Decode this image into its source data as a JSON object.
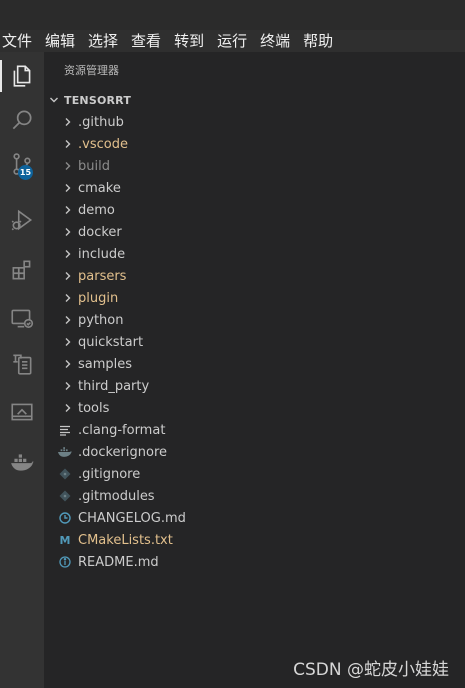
{
  "menubar": {
    "items": [
      "文件",
      "编辑",
      "选择",
      "查看",
      "转到",
      "运行",
      "终端",
      "帮助"
    ]
  },
  "activity_bar": {
    "items": [
      {
        "icon": "explorer-icon",
        "active": true
      },
      {
        "icon": "search-icon"
      },
      {
        "icon": "source-control-icon",
        "badge": "15"
      },
      {
        "icon": "run-debug-icon"
      },
      {
        "icon": "extensions-icon"
      },
      {
        "icon": "remote-explorer-icon"
      },
      {
        "icon": "testing-icon"
      },
      {
        "icon": "remote-window-icon"
      },
      {
        "icon": "docker-icon"
      }
    ]
  },
  "explorer": {
    "title": "资源管理器",
    "root_label": "TENSORRT",
    "items": [
      {
        "label": ".github",
        "type": "folder",
        "status": "normal"
      },
      {
        "label": ".vscode",
        "type": "folder",
        "status": "modified"
      },
      {
        "label": "build",
        "type": "folder",
        "status": "ignored"
      },
      {
        "label": "cmake",
        "type": "folder",
        "status": "normal"
      },
      {
        "label": "demo",
        "type": "folder",
        "status": "normal"
      },
      {
        "label": "docker",
        "type": "folder",
        "status": "normal"
      },
      {
        "label": "include",
        "type": "folder",
        "status": "normal"
      },
      {
        "label": "parsers",
        "type": "folder",
        "status": "modified"
      },
      {
        "label": "plugin",
        "type": "folder",
        "status": "modified"
      },
      {
        "label": "python",
        "type": "folder",
        "status": "normal"
      },
      {
        "label": "quickstart",
        "type": "folder",
        "status": "normal"
      },
      {
        "label": "samples",
        "type": "folder",
        "status": "normal"
      },
      {
        "label": "third_party",
        "type": "folder",
        "status": "normal"
      },
      {
        "label": "tools",
        "type": "folder",
        "status": "normal"
      },
      {
        "label": ".clang-format",
        "type": "file",
        "icon": "lines-icon",
        "status": "normal"
      },
      {
        "label": ".dockerignore",
        "type": "file",
        "icon": "docker-file-icon",
        "status": "normal"
      },
      {
        "label": ".gitignore",
        "type": "file",
        "icon": "git-file-icon",
        "status": "normal"
      },
      {
        "label": ".gitmodules",
        "type": "file",
        "icon": "git-file-icon",
        "status": "normal"
      },
      {
        "label": "CHANGELOG.md",
        "type": "file",
        "icon": "clock-icon",
        "status": "normal"
      },
      {
        "label": "CMakeLists.txt",
        "type": "file",
        "icon": "markdown-m-icon",
        "icon_text": "M",
        "status": "modified"
      },
      {
        "label": "README.md",
        "type": "file",
        "icon": "info-icon",
        "status": "normal"
      }
    ]
  },
  "watermark": "CSDN @蛇皮小娃娃",
  "colors": {
    "background": "#1e1e1e",
    "activity_bar": "#333333",
    "sidebar": "#252526",
    "text": "#cccccc",
    "modified": "#e2c08d",
    "ignored": "#8c8c8c",
    "badge": "#0e639c",
    "icon_blue": "#519aba"
  }
}
